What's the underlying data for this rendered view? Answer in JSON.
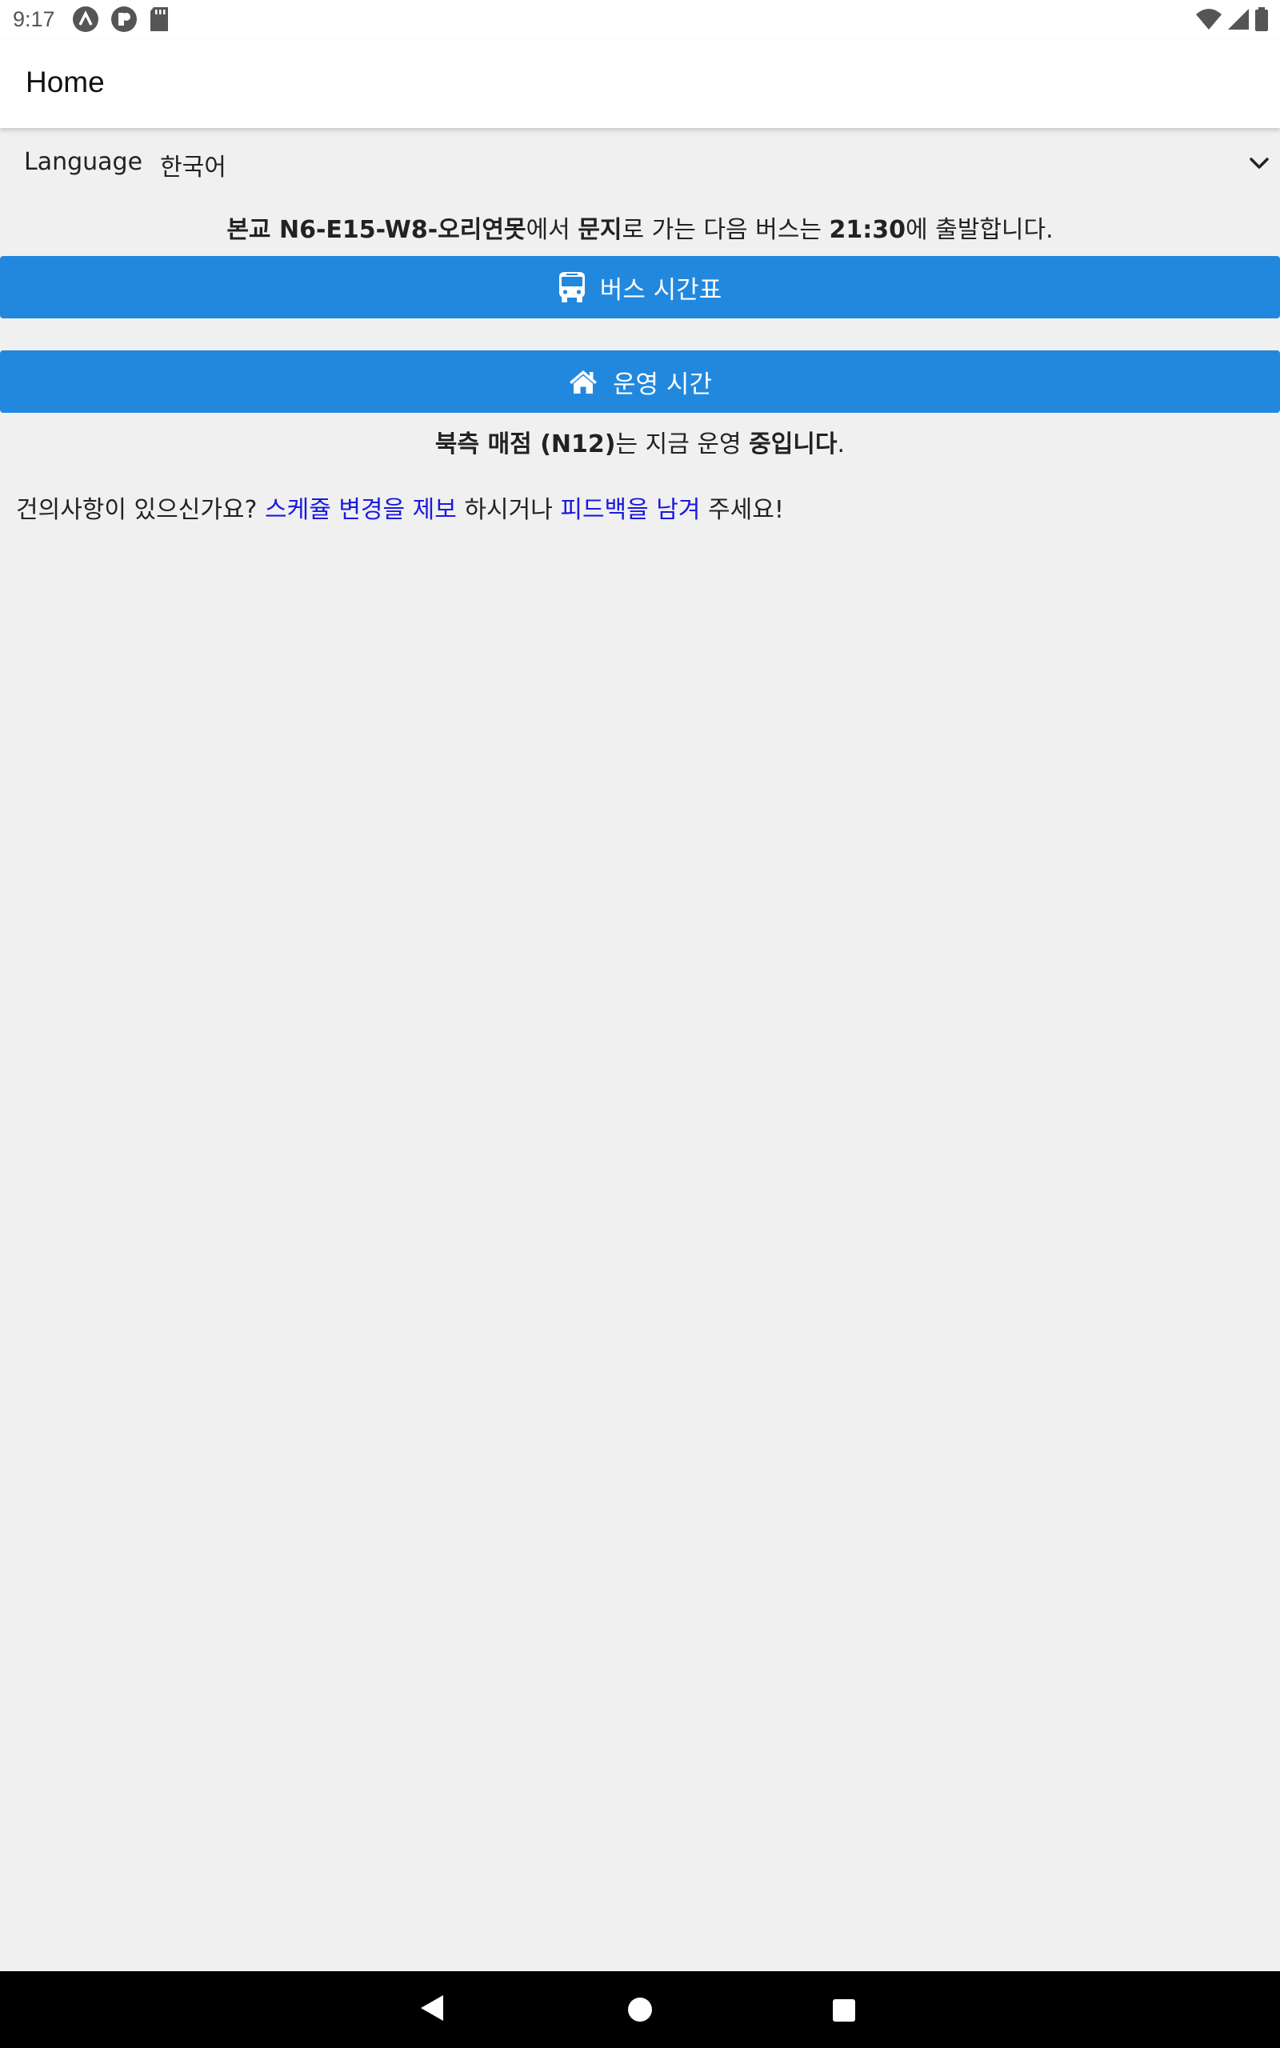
{
  "status_bar": {
    "time": "9:17"
  },
  "app_bar": {
    "title": "Home"
  },
  "language": {
    "label": "Language",
    "value": "한국어"
  },
  "next_bus": {
    "origin": "본교 N6-E15-W8-오리연못",
    "origin_suffix": "에서 ",
    "destination": "문지",
    "destination_suffix": "로 가는 다음 버스는 ",
    "time": "21:30",
    "time_suffix": "에 출발합니다."
  },
  "buttons": {
    "schedule_label": "버스 시간표",
    "hours_label": "운영 시간"
  },
  "store": {
    "name": "북측 매점 (N12)",
    "middle": "는 지금 운영 ",
    "status": "중입니다",
    "end": "."
  },
  "feedback": {
    "prefix": "건의사항이 있으신가요? ",
    "report_link": "스케쥴 변경을 제보",
    "middle": " 하시거나 ",
    "feedback_link": "피드백을 남겨",
    "suffix": " 주세요!"
  },
  "icons": {
    "bus": "bus-icon",
    "home": "home-icon",
    "chevron": "chevron-down-icon"
  },
  "colors": {
    "accent": "#2288dd",
    "link": "#1a1adf",
    "background": "#f0f0f0"
  }
}
